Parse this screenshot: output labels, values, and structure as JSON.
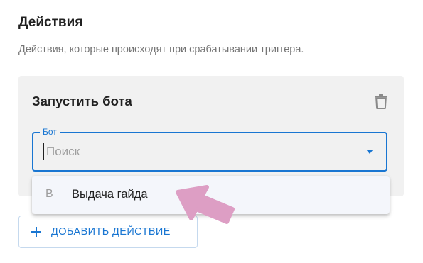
{
  "section": {
    "title": "Действия",
    "description": "Действия, которые происходят при срабатывании триггера."
  },
  "action_card": {
    "title": "Запустить бота",
    "delete_icon": "trash-icon",
    "bot_field": {
      "label": "Бот",
      "value": "",
      "placeholder": "Поиск"
    }
  },
  "dropdown": {
    "items": [
      {
        "letter": "В",
        "label": "Выдача гайда"
      }
    ]
  },
  "add_action": {
    "icon": "plus-icon",
    "label": "ДОБАВИТЬ ДЕЙСТВИЕ"
  },
  "annotation": {
    "icon": "pointer-arrow-icon",
    "color": "#dd9ec4"
  },
  "colors": {
    "accent": "#1976d2",
    "card_bg": "#f1f1f1",
    "menu_bg": "#f4f6fb"
  }
}
